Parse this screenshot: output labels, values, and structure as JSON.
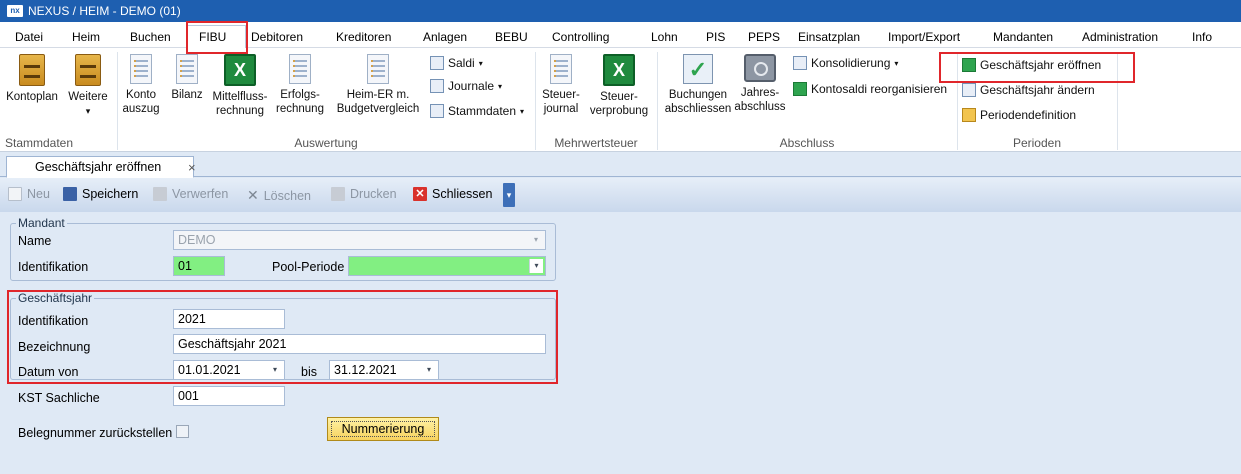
{
  "window": {
    "logo": "nx",
    "title": "NEXUS / HEIM - DEMO (01)"
  },
  "menu": [
    "Datei",
    "Heim",
    "Buchen",
    "FIBU",
    "Debitoren",
    "Kreditoren",
    "Anlagen",
    "BEBU",
    "Controlling",
    "Lohn",
    "PIS",
    "PEPS",
    "Einsatzplan",
    "Import/Export",
    "Mandanten",
    "Administration",
    "Info"
  ],
  "menu_active": "FIBU",
  "ribbon": {
    "stammdaten": {
      "label": "Stammdaten",
      "kontoplan": "Kontoplan",
      "weitere": "Weitere"
    },
    "auswertung": {
      "label": "Auswertung",
      "kontoauszug_1": "Konto",
      "kontoauszug_2": "auszug",
      "bilanz": "Bilanz",
      "mittelfluss_1": "Mittelfluss-",
      "mittelfluss_2": "rechnung",
      "erfolgs_1": "Erfolgs-",
      "erfolgs_2": "rechnung",
      "heim_1": "Heim-ER m.",
      "heim_2": "Budgetvergleich",
      "saldi": "Saldi",
      "journale": "Journale",
      "stammdaten": "Stammdaten"
    },
    "mwst": {
      "label": "Mehrwertsteuer",
      "steuerjournal_1": "Steuer-",
      "steuerjournal_2": "journal",
      "steuerverprobung_1": "Steuer-",
      "steuerverprobung_2": "verprobung"
    },
    "abschluss": {
      "label": "Abschluss",
      "buchungen_1": "Buchungen",
      "buchungen_2": "abschliessen",
      "jahres_1": "Jahres-",
      "jahres_2": "abschluss",
      "konsolidierung": "Konsolidierung",
      "kontosaldi": "Kontosaldi reorganisieren"
    },
    "perioden": {
      "label": "Perioden",
      "eroeffnen": "Geschäftsjahr eröffnen",
      "aendern": "Geschäftsjahr ändern",
      "definition": "Periodendefinition"
    }
  },
  "tab": {
    "label": "Geschäftsjahr eröffnen",
    "close": "×"
  },
  "toolbar": {
    "neu": "Neu",
    "speichern": "Speichern",
    "verwerfen": "Verwerfen",
    "loeschen": "Löschen",
    "drucken": "Drucken",
    "schliessen": "Schliessen"
  },
  "mandant": {
    "title": "Mandant",
    "name_label": "Name",
    "name_value": "DEMO",
    "id_label": "Identifikation",
    "id_value": "01",
    "pool_label": "Pool-Periode",
    "pool_value": ""
  },
  "geschaeftsjahr": {
    "title": "Geschäftsjahr",
    "id_label": "Identifikation",
    "id_value": "2021",
    "bez_label": "Bezeichnung",
    "bez_value": "Geschäftsjahr 2021",
    "datum_label": "Datum von",
    "datum_von": "01.01.2021",
    "bis_label": "bis",
    "datum_bis": "31.12.2021"
  },
  "kst": {
    "label": "KST Sachliche",
    "value": "001"
  },
  "beleg": {
    "label": "Belegnummer zurückstellen",
    "checked": false
  },
  "nummerierung": "Nummerierung",
  "colors": {
    "title_bar": "#1e5fb0",
    "highlight": "#e0262b",
    "green_field": "#82ef82",
    "button_yellow": "#f7d25e"
  }
}
